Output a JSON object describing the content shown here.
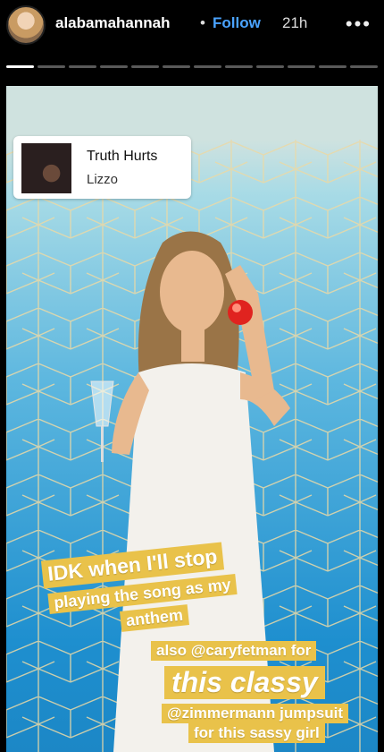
{
  "header": {
    "username": "alabamahannah",
    "separator": "•",
    "follow_label": "Follow",
    "time_ago": "21h",
    "more_icon": "more-icon"
  },
  "progress": {
    "segments": 12,
    "current": 1
  },
  "music_sticker": {
    "song": "Truth Hurts",
    "artist": "Lizzo"
  },
  "captions": {
    "line1": "IDK when I'll stop",
    "line2": "playing the song as my",
    "line3": "anthem",
    "line4": "also @caryfetman for",
    "line5": "this classy",
    "line6": "@zimmermann jumpsuit",
    "line7": "for this sassy girl"
  },
  "colors": {
    "caption_bg": "#e9c24a",
    "follow": "#4aa3ff",
    "wall_top": "#a8dbe6",
    "wall_bottom": "#1c87c6",
    "pattern_lines": "#ead9a6"
  }
}
